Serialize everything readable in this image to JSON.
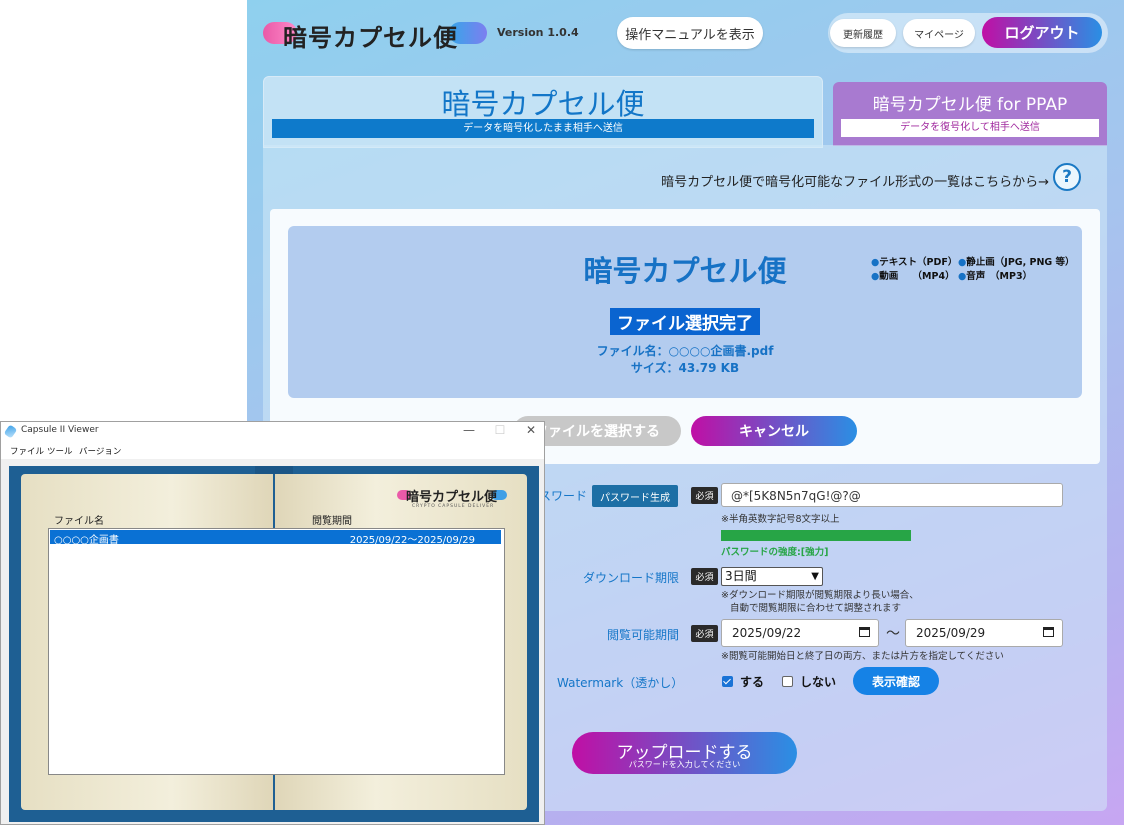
{
  "header": {
    "logo_text": "暗号カプセル便",
    "version": "Version 1.0.4",
    "manual_label": "操作マニュアルを表示",
    "history_label": "更新履歴",
    "mypage_label": "マイページ",
    "logout_label": "ログアウト"
  },
  "tabs": {
    "main": {
      "title": "暗号カプセル便",
      "subtitle": "データを暗号化したまま相手へ送信"
    },
    "ppap": {
      "title": "暗号カプセル便 for PPAP",
      "subtitle": "データを復号化して相手へ送信"
    }
  },
  "formats_link": "暗号カプセル便で暗号化可能なファイル形式の一覧はこちらから→",
  "help_icon": "?",
  "drop_zone": {
    "title": "暗号カプセル便",
    "formats": [
      "テキスト（PDF）",
      "静止画（JPG, PNG 等）",
      "動画　　（MP4）",
      "音声　（MP3）"
    ],
    "status": "ファイル選択完了",
    "file_name": "ファイル名：○○○○企画書.pdf",
    "file_size": "サイズ：43.79 KB"
  },
  "buttons": {
    "choose_file": "ファイルを選択する",
    "cancel": "キャンセル",
    "generate_password": "パスワード生成",
    "watermark_preview": "表示確認"
  },
  "form": {
    "password_label": "スワード",
    "required": "必須",
    "password_value": "@*[5K8N5n7qG!@?@",
    "password_note": "※半角英数字記号8文字以上",
    "strength": "パスワードの強度:[強力]",
    "strength_fraction": 1.0,
    "download_label": "ダウンロード期限",
    "download_value": "3日間",
    "download_note_1": "※ダウンロード期限が閲覧期限より長い場合、",
    "download_note_2": "自動で閲覧期限に合わせて調整されます",
    "view_label": "閲覧可能期間",
    "view_start": "2025/09/22",
    "view_end": "2025/09/29",
    "tilde": "〜",
    "view_note": "※閲覧可能開始日と終了日の両方、または片方を指定してください",
    "watermark_label": "Watermark（透かし）",
    "watermark_on": "する",
    "watermark_off": "しない"
  },
  "upload": {
    "label": "アップロードする",
    "sub": "パスワードを入力してください"
  },
  "viewer": {
    "title": "Capsule II Viewer",
    "controls": [
      "—",
      "☐",
      "✕"
    ],
    "menu": [
      "ファイル",
      "ツール",
      "バージョン"
    ],
    "logo_text": "暗号カプセル便",
    "logo_sub": "CRYPTO CAPSULE DELIVER",
    "col_name": "ファイル名",
    "col_period": "閲覧期間",
    "rows": [
      {
        "name": "○○○○企画書",
        "period": "2025/09/22〜2025/09/29"
      }
    ]
  },
  "colors": {
    "accent_blue": "#1576c8",
    "gradient_start": "#c00fa5",
    "gradient_end": "#2a8fe4",
    "ppap_purple": "#a87ad0",
    "strength_green": "#27a546",
    "selection_blue": "#0a71d4"
  }
}
